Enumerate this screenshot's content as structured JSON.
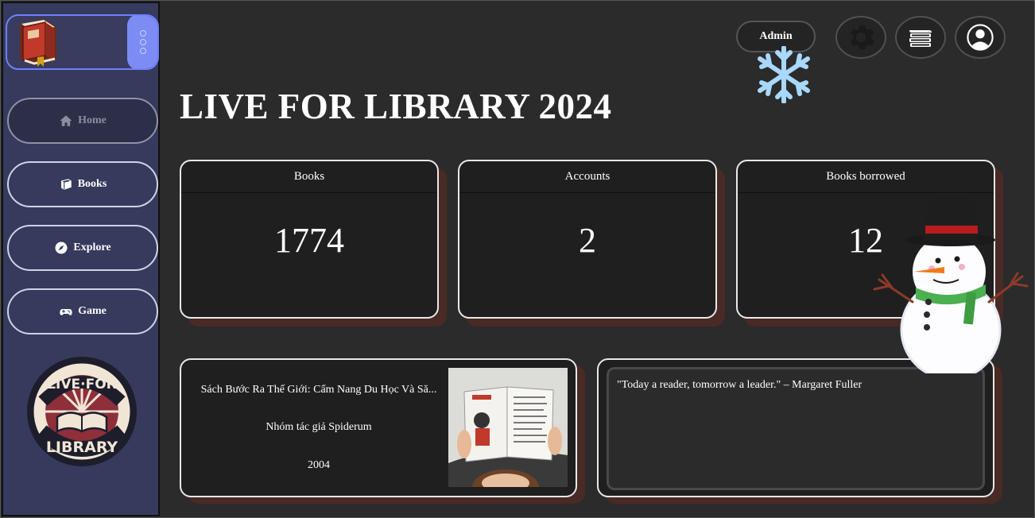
{
  "header": {
    "title": "LIVE FOR LIBRARY 2024",
    "user_label": "Admin",
    "icons": [
      "gear-icon",
      "books-stack-icon",
      "user-icon"
    ]
  },
  "sidebar": {
    "items": [
      {
        "label": "Home",
        "icon": "home-icon",
        "active": true
      },
      {
        "label": "Books",
        "icon": "book-icon",
        "active": false
      },
      {
        "label": "Explore",
        "icon": "compass-icon",
        "active": false
      },
      {
        "label": "Game",
        "icon": "gamepad-icon",
        "active": false
      }
    ],
    "badge_text": [
      "LIVE",
      "FOR",
      "LIBRARY"
    ]
  },
  "stats": [
    {
      "label": "Books",
      "value": "1774"
    },
    {
      "label": "Accounts",
      "value": "2"
    },
    {
      "label": "Books borrowed",
      "value": "12"
    }
  ],
  "featured_book": {
    "title": "Sách Bước Ra Thế Giới: Cẩm Nang Du Học Và Să...",
    "author": "Nhóm tác giả Spiderum",
    "year": "2004"
  },
  "quote": {
    "text": "\"Today a reader, tomorrow a leader.\" – Margaret Fuller"
  },
  "colors": {
    "background": "#2b2b2b",
    "sidebar": "#363a5c",
    "accent": "#7c8cf4",
    "card_shadow": "#4a2a24"
  }
}
